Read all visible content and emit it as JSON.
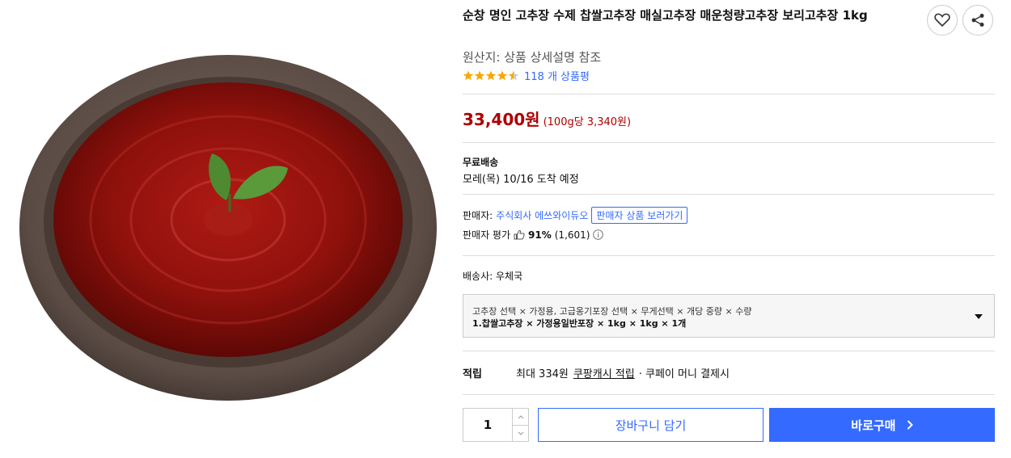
{
  "product": {
    "title": "순창 명인 고추장 수제 찹쌀고추장 매실고추장 매운청량고추장 보리고추장 1kg",
    "origin": "원산지: 상품 상세설명 참조",
    "rating_value": 4.5,
    "review_count": "118 개 상품평",
    "image_icon": "red-pepper-paste-in-earthenware-bowl"
  },
  "actions": {
    "wishlist_icon": "heart-icon",
    "share_icon": "share-icon"
  },
  "price": {
    "main": "33,400원",
    "unit": "(100g당 3,340원)",
    "color": "#ae0000"
  },
  "shipping": {
    "free_label": "무료배송",
    "arrival": "모레(목) 10/16 도착 예정"
  },
  "seller": {
    "label": "판매자:",
    "name": "주식회사 에쓰와이듀오",
    "view_button": "판매자 상품 보러가기",
    "rating_label": "판매자 평가",
    "rating_pct": "91%",
    "rating_count": "(1,601)"
  },
  "courier": {
    "label": "배송사:",
    "name": "우체국"
  },
  "option": {
    "line1": "고추장 선택 × 가정용, 고급옹기포장 선택 × 무게선택 × 개당 중량 × 수량",
    "line2": "1.찹쌀고추장 × 가정용일반포장 × 1kg × 1kg × 1개"
  },
  "reward": {
    "label": "적립",
    "text": "최대 334원",
    "link": "쿠팡캐시 적립",
    "tail": "· 쿠페이 머니 결제시"
  },
  "purchase": {
    "quantity": "1",
    "cart_label": "장바구니 담기",
    "buy_label": "바로구매",
    "accent": "#346aff"
  }
}
